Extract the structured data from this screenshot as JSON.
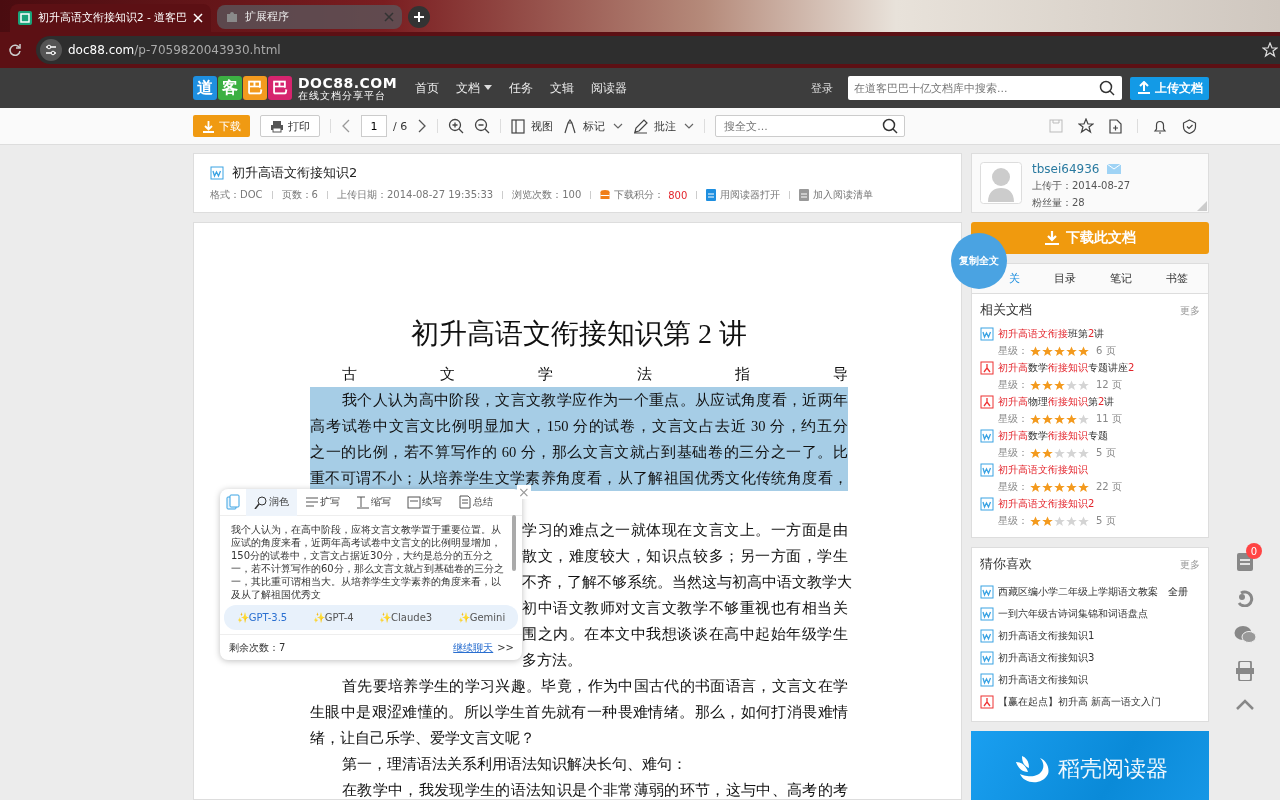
{
  "browser": {
    "tabs": [
      {
        "title": "初升高语文衔接知识2 - 道客巴",
        "selected": true
      },
      {
        "title": "扩展程序",
        "selected": false
      }
    ],
    "url_host": "doc88.com",
    "url_path": "/p-7059820043930.html"
  },
  "site_header": {
    "logo": "道客巴巴",
    "domain": "DOC88.COM",
    "tagline": "在线文档分享平台",
    "nav": [
      {
        "label": "首页",
        "dropdown": false
      },
      {
        "label": "文档",
        "dropdown": true
      },
      {
        "label": "任务",
        "dropdown": false
      },
      {
        "label": "文辑",
        "dropdown": false
      },
      {
        "label": "阅读器",
        "dropdown": false
      }
    ],
    "login": "登录",
    "search_placeholder": "在道客巴巴十亿文档库中搜索...",
    "upload": "上传文档"
  },
  "toolbar": {
    "download": "下载",
    "print": "打印",
    "page": "1",
    "total": "/ 6",
    "view": "视图",
    "mark": "标记",
    "annotate": "批注",
    "search_placeholder": "搜全文..."
  },
  "doc_info": {
    "title": "初升高语文衔接知识2",
    "meta": [
      "格式：DOC",
      "页数：6",
      "上传日期：2014-08-27 19:35:33",
      "浏览次数：100"
    ],
    "points_label": "下载积分：",
    "points": "800",
    "open_reader": "用阅读器打开",
    "add_list": "加入阅读清单"
  },
  "document": {
    "title": "初升高语文衔接知识第 2 讲",
    "lines": [
      {
        "kind": "indent",
        "text": "古文学法指导",
        "highlighted": false
      },
      {
        "kind": "indent",
        "text": "我个人认为高中阶段，文言文教学应作为一个重点。从应试角度看，近两年",
        "highlighted": true
      },
      {
        "kind": "full",
        "text": "高考试卷中文言文比例明显加大，150 分的试卷，文言文占去近 30 分，约五分",
        "highlighted": true
      },
      {
        "kind": "full",
        "text": "之一的比例，若不算写作的 60 分，那么文言文就占到基础卷的三分之一了。比",
        "highlighted": true
      },
      {
        "kind": "full",
        "text": "重不可谓不小；从培养学生文学素养角度看，从了解祖国优秀文化传统角度看，",
        "highlighted": true
      },
      {
        "kind": "clipped",
        "text": "学习的难点之一就体现在文言文上。一方面是由",
        "highlighted": false
      },
      {
        "kind": "clipped",
        "text": "散文，难度较大，知识点较多；另一方面，学生",
        "highlighted": false
      },
      {
        "kind": "clipped",
        "text": "不齐，了解不够系统。当然这与初高中语文教学大",
        "highlighted": false
      },
      {
        "kind": "clipped",
        "text": "初中语文教师对文言文教学不够重视也有相当关",
        "highlighted": false
      },
      {
        "kind": "clipped",
        "text": "围之内。在本文中我想谈谈在高中起始年级学生",
        "highlighted": false
      },
      {
        "kind": "clipped-last",
        "text": "多方法。",
        "highlighted": false
      },
      {
        "kind": "indent",
        "text": "首先要培养学生的学习兴趣。毕竟，作为中国古代的书面语言，文言文在学",
        "highlighted": false
      },
      {
        "kind": "full",
        "text": "生眼中是艰涩难懂的。所以学生首先就有一种畏难情绪。那么，如何打消畏难情",
        "highlighted": false
      },
      {
        "kind": "last",
        "text": "绪，让自己乐学、爱学文言文呢？",
        "highlighted": false
      },
      {
        "kind": "indent-last",
        "text": "第一，理清语法关系利用语法知识解决长句、难句：",
        "highlighted": false
      },
      {
        "kind": "indent",
        "text": "在教学中，我发现学生的语法知识是个非常薄弱的环节，这与中、高考的考",
        "highlighted": false
      }
    ]
  },
  "ai_popup": {
    "tabs": [
      {
        "label": "润色",
        "selected": true
      },
      {
        "label": "扩写",
        "selected": false
      },
      {
        "label": "缩写",
        "selected": false
      },
      {
        "label": "续写",
        "selected": false
      },
      {
        "label": "总结",
        "selected": false
      }
    ],
    "text": "我个人认为，在高中阶段，应将文言文教学置于重要位置。从应试的角度来看，近两年高考试卷中文言文的比例明显增加，150分的试卷中，文言文占据近30分，大约是总分的五分之一，若不计算写作的60分，那么文言文就占到基础卷的三分之一，其比重可谓相当大。从培养学生文学素养的角度来看，以及从了解祖国优秀文",
    "models": [
      {
        "label": "✨GPT-3.5",
        "selected": true
      },
      {
        "label": "✨GPT-4",
        "selected": false
      },
      {
        "label": "✨Claude3",
        "selected": false
      },
      {
        "label": "✨Gemini",
        "selected": false
      }
    ],
    "remaining": "剩余次数：7",
    "continue": "继续聊天",
    "arrows": ">>",
    "close": "×"
  },
  "copy_all": "复制全文",
  "uploader": {
    "name": "tbsei64936",
    "uploaded": "上传于：2014-08-27",
    "fans": "粉丝量：28"
  },
  "download_button": "下载此文档",
  "side_tabs": [
    {
      "label": "关",
      "selected": true
    },
    {
      "label": "目录",
      "selected": false
    },
    {
      "label": "笔记",
      "selected": false
    },
    {
      "label": "书签",
      "selected": false
    }
  ],
  "related": {
    "title": "相关文档",
    "more": "更多",
    "items": [
      {
        "kind": "word",
        "title": [
          {
            "text": "初升高语文衔接",
            "hl": true
          },
          {
            "text": "班第",
            "hl": false
          },
          {
            "text": "2",
            "hl": true
          },
          {
            "text": "讲",
            "hl": false
          }
        ],
        "stars_label": "星级：",
        "stars": 5,
        "pages": "6 页"
      },
      {
        "kind": "pdf",
        "title": [
          {
            "text": "初升高",
            "hl": true
          },
          {
            "text": "数学",
            "hl": false
          },
          {
            "text": "衔接知识",
            "hl": true
          },
          {
            "text": "专题讲座",
            "hl": false
          },
          {
            "text": "2",
            "hl": true
          }
        ],
        "stars_label": "星级：",
        "stars": 3,
        "pages": "12 页"
      },
      {
        "kind": "pdf",
        "title": [
          {
            "text": "初升高",
            "hl": true
          },
          {
            "text": "物理",
            "hl": false
          },
          {
            "text": "衔接知识",
            "hl": true
          },
          {
            "text": "第",
            "hl": false
          },
          {
            "text": "2",
            "hl": true
          },
          {
            "text": "讲",
            "hl": false
          }
        ],
        "stars_label": "星级：",
        "stars": 4,
        "pages": "11 页"
      },
      {
        "kind": "word",
        "title": [
          {
            "text": "初升高",
            "hl": true
          },
          {
            "text": "数学",
            "hl": false
          },
          {
            "text": "衔接知识",
            "hl": true
          },
          {
            "text": "专题",
            "hl": false
          }
        ],
        "stars_label": "星级：",
        "stars": 2,
        "pages": "5 页"
      },
      {
        "kind": "word",
        "title": [
          {
            "text": "初升高语文衔接知识",
            "hl": true
          }
        ],
        "stars_label": "星级：",
        "stars": 5,
        "pages": "22 页"
      },
      {
        "kind": "word",
        "title": [
          {
            "text": "初升高语文衔接知识2",
            "hl": true
          }
        ],
        "stars_label": "星级：",
        "stars": 2,
        "pages": "5 页"
      }
    ]
  },
  "guess": {
    "title": "猜你喜欢",
    "more": "更多",
    "items": [
      {
        "kind": "word",
        "title": "西藏区编小学二年级上学期语文教案　全册"
      },
      {
        "kind": "word",
        "title": "一到六年级古诗词集锦和词语盘点"
      },
      {
        "kind": "word",
        "title": "初升高语文衔接知识1"
      },
      {
        "kind": "word",
        "title": "初升高语文衔接知识3"
      },
      {
        "kind": "word",
        "title": "初升高语文衔接知识"
      },
      {
        "kind": "pdf",
        "title": "【赢在起点】初升高 新高一语文入门"
      }
    ]
  },
  "banner": {
    "text": "稻壳阅读器"
  },
  "float_bar": {
    "badge": "0"
  }
}
